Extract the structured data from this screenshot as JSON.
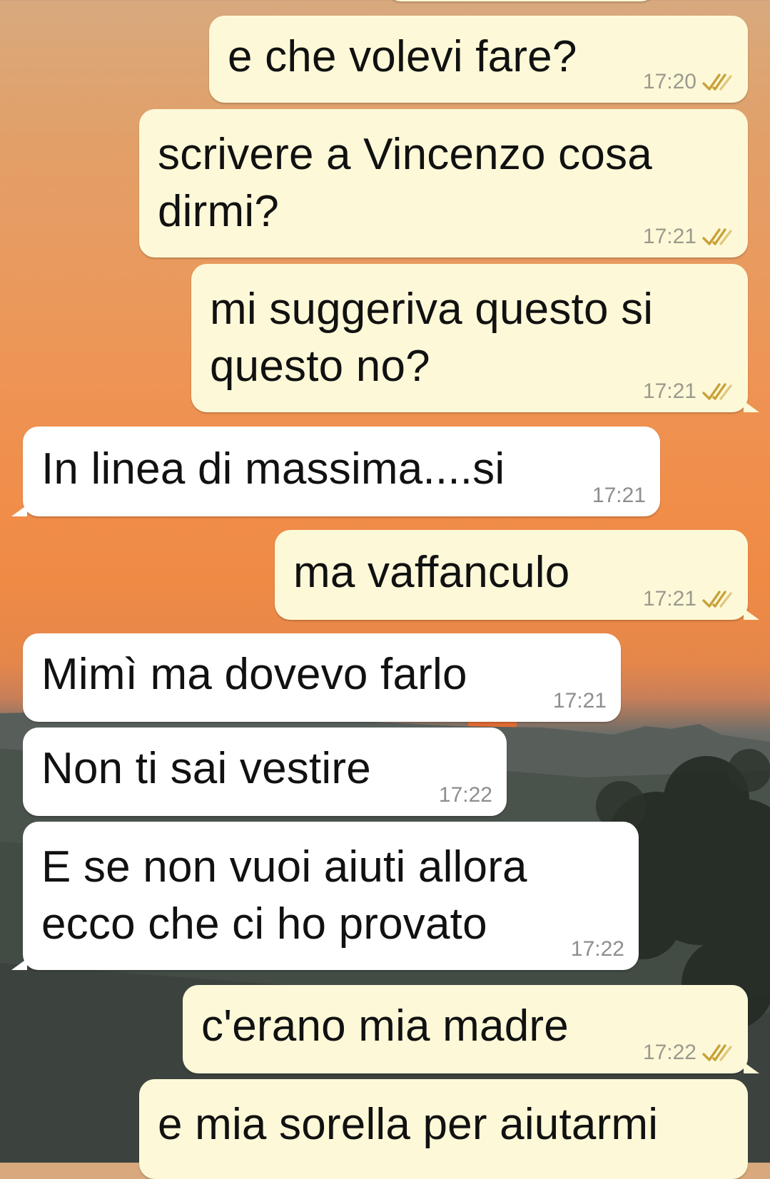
{
  "conversation": {
    "messages": [
      {
        "direction": "out",
        "text": "e che volevi fare?",
        "time": "17:20",
        "status": "read"
      },
      {
        "direction": "out",
        "text": "scrivere a Vincenzo cosa\ndirmi?",
        "time": "17:21",
        "status": "read"
      },
      {
        "direction": "out",
        "text": "mi suggeriva questo si\nquesto no?",
        "time": "17:21",
        "status": "read"
      },
      {
        "direction": "in",
        "text": "In linea di massima....si",
        "time": "17:21"
      },
      {
        "direction": "out",
        "text": "ma vaffanculo",
        "time": "17:21",
        "status": "read"
      },
      {
        "direction": "in",
        "text": "Mimì ma dovevo farlo",
        "time": "17:21"
      },
      {
        "direction": "in",
        "text": "Non ti sai vestire",
        "time": "17:22"
      },
      {
        "direction": "in",
        "text": "E se non vuoi aiuti allora\necco che ci ho provato",
        "time": "17:22"
      },
      {
        "direction": "out",
        "text": "c'erano mia madre",
        "time": "17:22",
        "status": "read"
      },
      {
        "direction": "out",
        "text": "e mia sorella per aiutarmi",
        "time": "",
        "status": ""
      }
    ]
  },
  "icons": {
    "read_receipt": "double-check-icon"
  },
  "colors": {
    "outgoing_bubble": "#fdf9d8",
    "incoming_bubble": "#ffffff",
    "meta_text": "#9a9a8e",
    "tick": "#c9a13a"
  }
}
